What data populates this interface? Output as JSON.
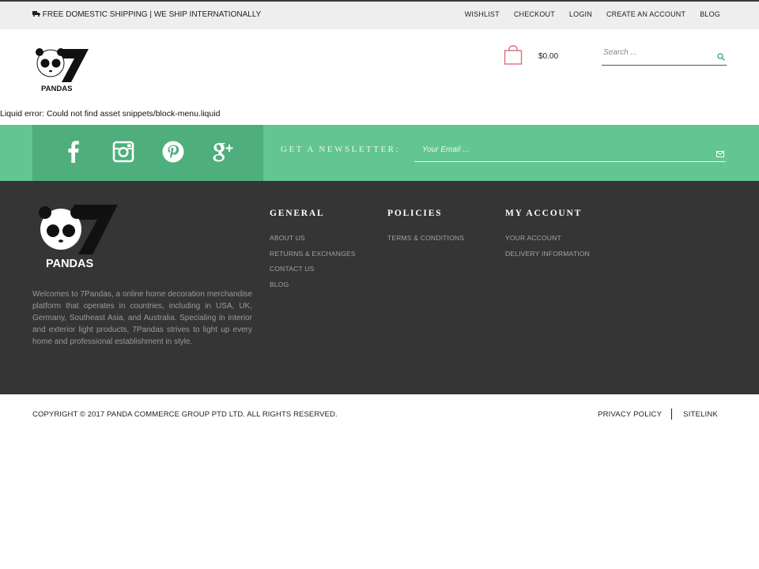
{
  "topbar": {
    "shipping": "FREE DOMESTIC SHIPPING | WE SHIP INTERNATIONALLY",
    "links": [
      "WISHLIST",
      "CHECKOUT",
      "LOGIN",
      "CREATE AN ACCOUNT",
      "BLOG"
    ]
  },
  "brand": {
    "logo_text": "PANDAS",
    "logo_number": "7"
  },
  "header": {
    "cart_total": "$0.00",
    "search_placeholder": "Search ...",
    "icons": {
      "cart": "shopping-bag-icon",
      "search": "search-icon"
    }
  },
  "error_message": "Liquid error: Could not find asset snippets/block-menu.liquid",
  "newsletter": {
    "label": "GET A NEWSLETTER:",
    "placeholder": "Your Email ...",
    "social": [
      "facebook-icon",
      "instagram-icon",
      "pinterest-icon",
      "google-plus-icon"
    ]
  },
  "footer": {
    "about": "Welcomes to 7Pandas, a online home decoration merchandise platform that operates in countries, including in USA, UK, Germany, Southeast Asia, and Australia. Specialing in interior and exterior light products, 7Pandas strives to light up every home and professional establishment in style.",
    "columns": [
      {
        "title": "GENERAL",
        "links": [
          "ABOUT US",
          "RETURNS & EXCHANGES",
          "CONTACT US",
          "BLOG"
        ]
      },
      {
        "title": "POLICIES",
        "links": [
          "TERMS & CONDITIONS"
        ]
      },
      {
        "title": "MY ACCOUNT",
        "links": [
          "YOUR ACCOUNT",
          "DELIVERY INFORMATION"
        ]
      }
    ]
  },
  "bottom": {
    "copyright": "COPYRIGHT © 2017 PANDA COMMERCE GROUP PTD LTD. ALL RIGHTS RESERVED.",
    "links": [
      "PRIVACY POLICY",
      "SITELINK"
    ]
  },
  "colors": {
    "accent": "#63c591",
    "accent_dark": "#4eaf7c",
    "footer_bg": "#353535",
    "cart": "#d9707c"
  }
}
